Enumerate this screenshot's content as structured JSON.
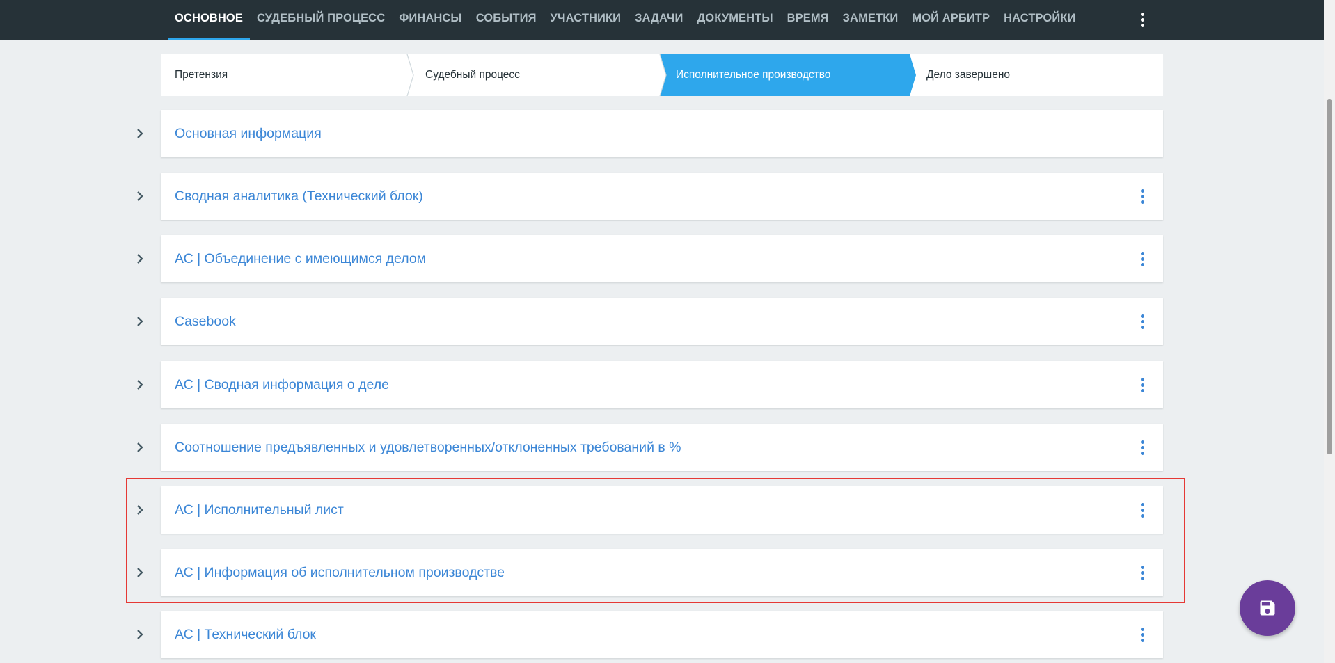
{
  "nav": {
    "tabs": [
      {
        "label": "ОСНОВНОЕ",
        "active": true
      },
      {
        "label": "СУДЕБНЫЙ ПРОЦЕСС"
      },
      {
        "label": "ФИНАНСЫ"
      },
      {
        "label": "СОБЫТИЯ"
      },
      {
        "label": "УЧАСТНИКИ"
      },
      {
        "label": "ЗАДАЧИ"
      },
      {
        "label": "ДОКУМЕНТЫ"
      },
      {
        "label": "ВРЕМЯ"
      },
      {
        "label": "ЗАМЕТКИ"
      },
      {
        "label": "МОЙ АРБИТР"
      },
      {
        "label": "НАСТРОЙКИ"
      }
    ],
    "more_icon": "more-vert-icon"
  },
  "stepper": {
    "steps": [
      {
        "label": "Претензия"
      },
      {
        "label": "Судебный процесс"
      },
      {
        "label": "Исполнительное производство",
        "active": true
      },
      {
        "label": "Дело завершено"
      }
    ]
  },
  "panels": [
    {
      "title": "Основная информация",
      "has_menu": false
    },
    {
      "title": "Сводная аналитика (Технический блок)",
      "has_menu": true
    },
    {
      "title": "АС | Объединение с имеющимся делом",
      "has_menu": true
    },
    {
      "title": "Casebook",
      "has_menu": true
    },
    {
      "title": "АС | Сводная информация о деле",
      "has_menu": true
    },
    {
      "title": "Соотношение предъявленных и удовлетворенных/отклоненных требований в %",
      "has_menu": true
    },
    {
      "title": "АС | Исполнительный лист",
      "has_menu": true
    },
    {
      "title": "АС | Информация об исполнительном производстве",
      "has_menu": true
    },
    {
      "title": "АС | Технический блок",
      "has_menu": true
    }
  ],
  "fab": {
    "icon": "save-icon"
  },
  "colors": {
    "topbar": "#263238",
    "active_tab_underline": "#2ea7ec",
    "active_step": "#2ea7ec",
    "panel_title": "#3b86d6",
    "fab": "#6a3d9a",
    "highlight": "#e53935"
  }
}
